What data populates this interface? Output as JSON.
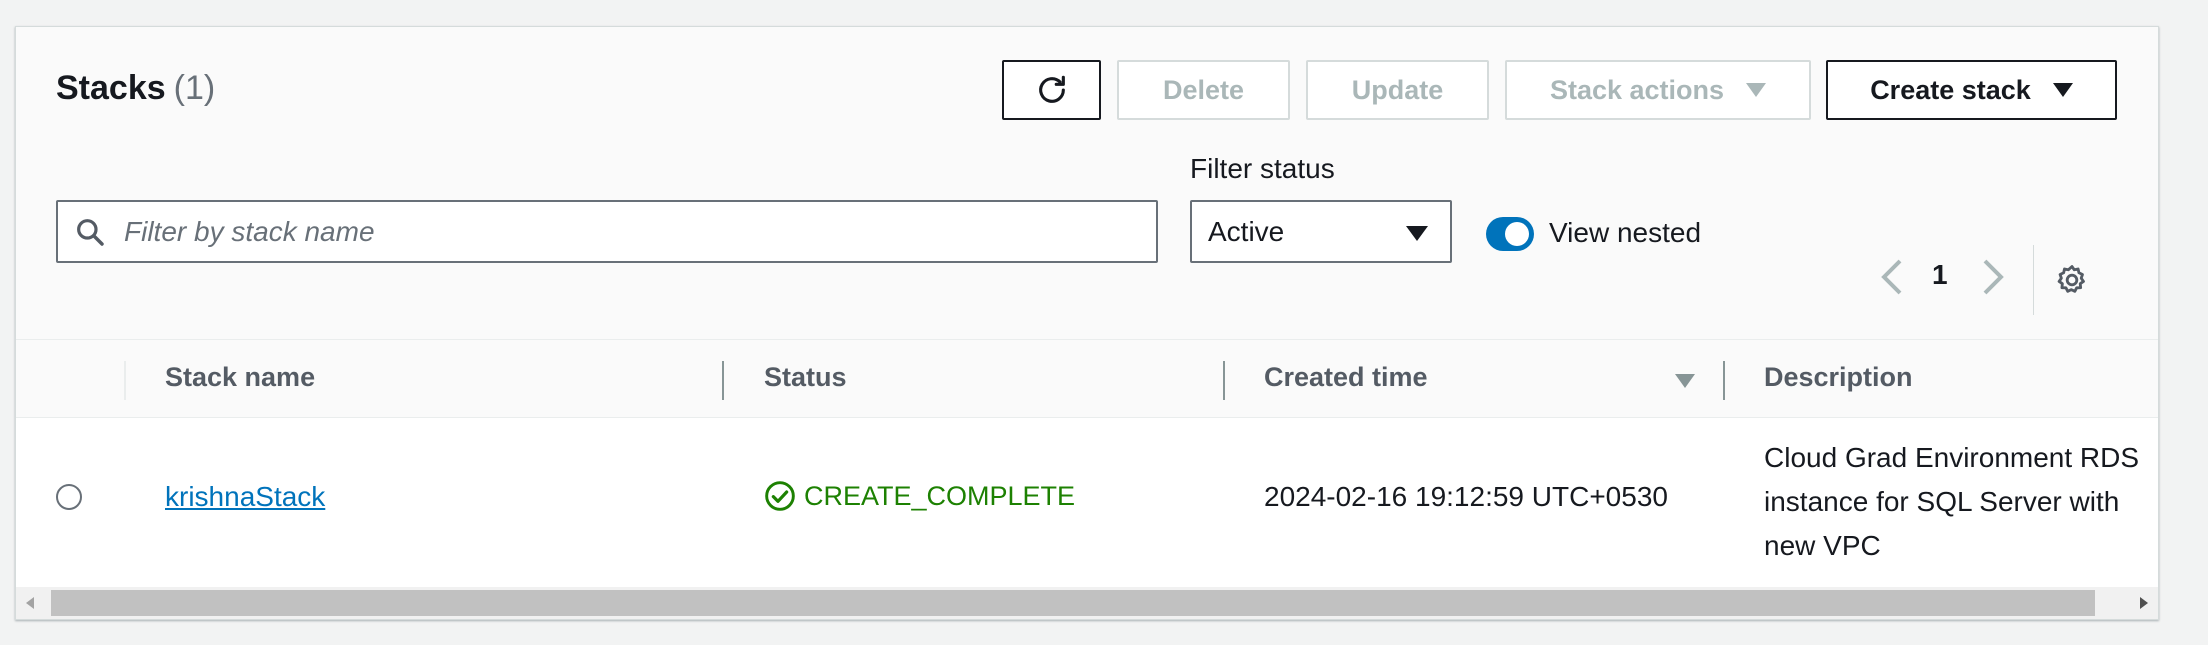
{
  "header": {
    "title": "Stacks",
    "count": "(1)"
  },
  "toolbar": {
    "refresh_icon": "refresh-icon",
    "delete_label": "Delete",
    "update_label": "Update",
    "stack_actions_label": "Stack actions",
    "create_stack_label": "Create stack"
  },
  "search": {
    "placeholder": "Filter by stack name",
    "value": ""
  },
  "filter_status": {
    "label": "Filter status",
    "selected": "Active"
  },
  "view_nested": {
    "label": "View nested",
    "enabled": true
  },
  "pagination": {
    "current_page": "1"
  },
  "table": {
    "columns": [
      "Stack name",
      "Status",
      "Created time",
      "Description"
    ],
    "rows": [
      {
        "stack_name": "krishnaStack",
        "status": "CREATE_COMPLETE",
        "created_time": "2024-02-16 19:12:59 UTC+0530",
        "description": [
          "Cloud Grad Environment RDS",
          "instance for SQL Server with",
          "new VPC"
        ]
      }
    ]
  },
  "colors": {
    "accent": "#0073bb",
    "success": "#1d8102",
    "text": "#16191f",
    "muted": "#687078"
  }
}
